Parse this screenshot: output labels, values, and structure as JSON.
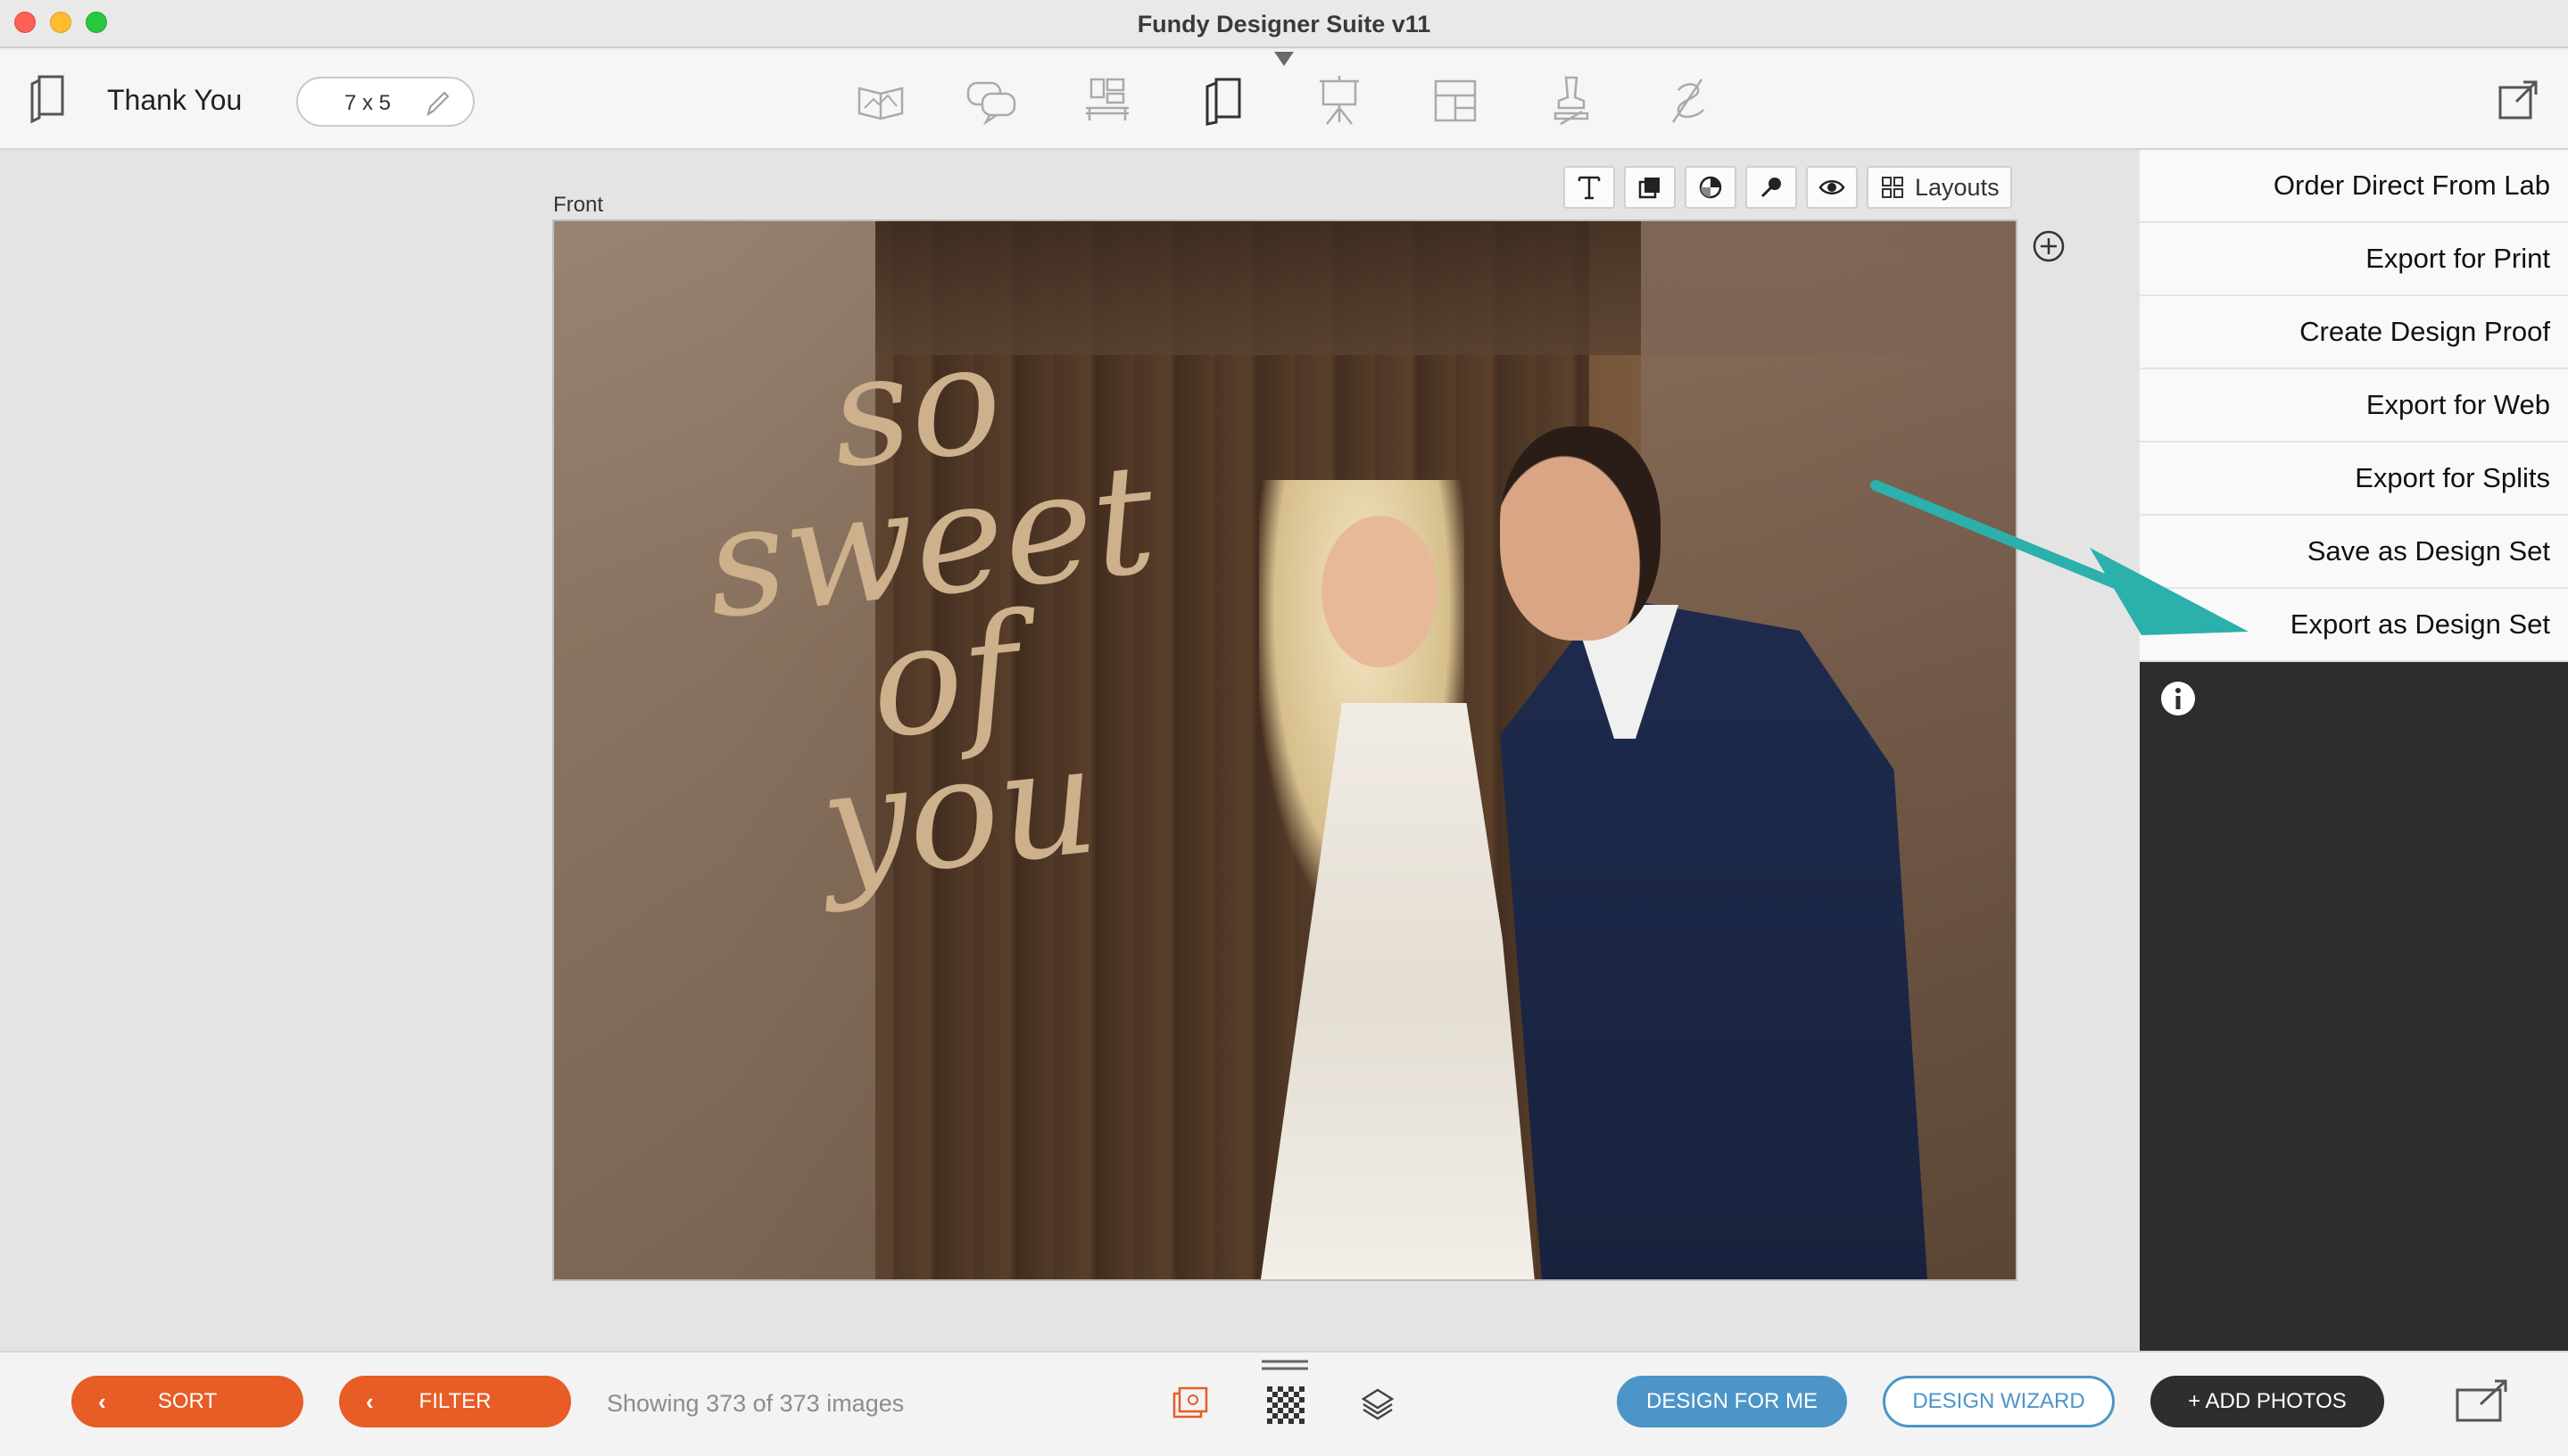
{
  "window": {
    "title": "Fundy Designer Suite v11"
  },
  "toolbar": {
    "product_name": "Thank You",
    "size": "7 x 5",
    "modes": [
      "album-icon",
      "chat-bubbles-icon",
      "wall-collage-icon",
      "cards-icon",
      "easel-icon",
      "layout-panel-icon",
      "stamp-icon",
      "signature-icon"
    ],
    "active_mode": "cards-icon"
  },
  "canvas": {
    "page_label": "Front",
    "tools": {
      "layouts_label": "Layouts"
    },
    "text_overlay": [
      "so",
      "sweet",
      "of",
      "you"
    ]
  },
  "export_menu": {
    "items": [
      "Order Direct From Lab",
      "Export for Print",
      "Create Design Proof",
      "Export for Web",
      "Export for Splits",
      "Save as Design Set",
      "Export as Design Set"
    ]
  },
  "bottom_bar": {
    "sort_label": "SORT",
    "filter_label": "FILTER",
    "status": "Showing 373 of 373 images",
    "design_for_me": "DESIGN FOR ME",
    "design_wizard": "DESIGN WIZARD",
    "add_photos": "+ ADD PHOTOS"
  },
  "colors": {
    "accent_orange": "#e85c26",
    "accent_blue": "#4c95c8",
    "arrow_teal": "#2bb0ac",
    "script_text": "#cdb08c"
  }
}
